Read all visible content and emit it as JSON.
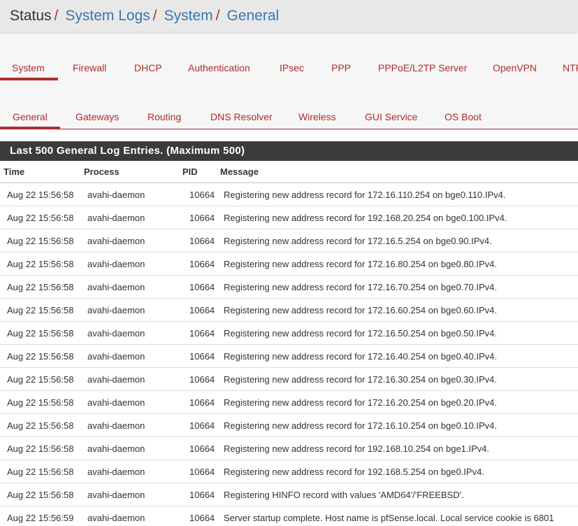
{
  "breadcrumb": {
    "root": "Status",
    "links": [
      "System Logs",
      "System",
      "General"
    ],
    "separator": "/"
  },
  "tabs_primary": [
    {
      "label": "System",
      "active": true
    },
    {
      "label": "Firewall",
      "active": false
    },
    {
      "label": "DHCP",
      "active": false
    },
    {
      "label": "Authentication",
      "active": false
    },
    {
      "label": "IPsec",
      "active": false
    },
    {
      "label": "PPP",
      "active": false
    },
    {
      "label": "PPPoE/L2TP Server",
      "active": false
    },
    {
      "label": "OpenVPN",
      "active": false
    },
    {
      "label": "NTP",
      "active": false
    }
  ],
  "tabs_secondary": [
    {
      "label": "General",
      "active": true
    },
    {
      "label": "Gateways",
      "active": false
    },
    {
      "label": "Routing",
      "active": false
    },
    {
      "label": "DNS Resolver",
      "active": false
    },
    {
      "label": "Wireless",
      "active": false
    },
    {
      "label": "GUI Service",
      "active": false
    },
    {
      "label": "OS Boot",
      "active": false
    }
  ],
  "panel": {
    "title": "Last 500 General Log Entries. (Maximum 500)"
  },
  "table": {
    "columns": [
      "Time",
      "Process",
      "PID",
      "Message"
    ],
    "rows": [
      [
        "Aug 22 15:56:58",
        "avahi-daemon",
        "10664",
        "Registering new address record for 172.16.110.254 on bge0.110.IPv4."
      ],
      [
        "Aug 22 15:56:58",
        "avahi-daemon",
        "10664",
        "Registering new address record for 192.168.20.254 on bge0.100.IPv4."
      ],
      [
        "Aug 22 15:56:58",
        "avahi-daemon",
        "10664",
        "Registering new address record for 172.16.5.254 on bge0.90.IPv4."
      ],
      [
        "Aug 22 15:56:58",
        "avahi-daemon",
        "10664",
        "Registering new address record for 172.16.80.254 on bge0.80.IPv4."
      ],
      [
        "Aug 22 15:56:58",
        "avahi-daemon",
        "10664",
        "Registering new address record for 172.16.70.254 on bge0.70.IPv4."
      ],
      [
        "Aug 22 15:56:58",
        "avahi-daemon",
        "10664",
        "Registering new address record for 172.16.60.254 on bge0.60.IPv4."
      ],
      [
        "Aug 22 15:56:58",
        "avahi-daemon",
        "10664",
        "Registering new address record for 172.16.50.254 on bge0.50.IPv4."
      ],
      [
        "Aug 22 15:56:58",
        "avahi-daemon",
        "10664",
        "Registering new address record for 172.16.40.254 on bge0.40.IPv4."
      ],
      [
        "Aug 22 15:56:58",
        "avahi-daemon",
        "10664",
        "Registering new address record for 172.16.30.254 on bge0.30.IPv4."
      ],
      [
        "Aug 22 15:56:58",
        "avahi-daemon",
        "10664",
        "Registering new address record for 172.16.20.254 on bge0.20.IPv4."
      ],
      [
        "Aug 22 15:56:58",
        "avahi-daemon",
        "10664",
        "Registering new address record for 172.16.10.254 on bge0.10.IPv4."
      ],
      [
        "Aug 22 15:56:58",
        "avahi-daemon",
        "10664",
        "Registering new address record for 192.168.10.254 on bge1.IPv4."
      ],
      [
        "Aug 22 15:56:58",
        "avahi-daemon",
        "10664",
        "Registering new address record for 192.168.5.254 on bge0.IPv4."
      ],
      [
        "Aug 22 15:56:58",
        "avahi-daemon",
        "10664",
        "Registering HINFO record with values 'AMD64'/'FREEBSD'."
      ],
      [
        "Aug 22 15:56:59",
        "avahi-daemon",
        "10664",
        "Server startup complete. Host name is pfSense.local. Local service cookie is 6801"
      ]
    ]
  },
  "colors": {
    "accent": "#b02c2c",
    "link": "#3777b3",
    "panel_heading": "#3b3b3b"
  }
}
